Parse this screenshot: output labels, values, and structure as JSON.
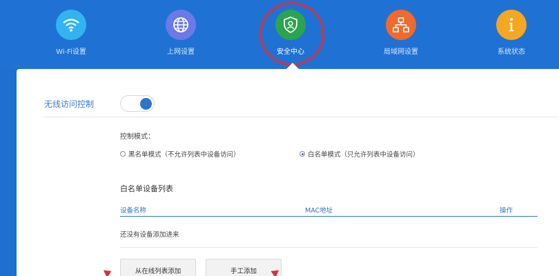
{
  "nav": {
    "items": [
      {
        "label": "Wi-Fi设置",
        "icon": "wifi-icon",
        "color": "#33b4f0"
      },
      {
        "label": "上网设置",
        "icon": "globe-icon",
        "color": "#6b7ae8"
      },
      {
        "label": "安全中心",
        "icon": "shield-user-icon",
        "color": "#2aa44f",
        "active": true
      },
      {
        "label": "局域网设置",
        "icon": "network-icon",
        "color": "#ef6a2c"
      },
      {
        "label": "系统状态",
        "icon": "info-icon",
        "color": "#f5a623"
      }
    ]
  },
  "colors": {
    "header_bg": "#1f72d4",
    "accent": "#2f74c9",
    "annotation_red": "#d8303b"
  },
  "wireless_access": {
    "title": "无线访问控制",
    "toggle_on": true
  },
  "control_mode": {
    "label": "控制模式：",
    "options": [
      {
        "label": "黑名单模式（不允许列表中设备访问）",
        "checked": false
      },
      {
        "label": "白名单模式（只允许列表中设备访问）",
        "checked": true
      }
    ]
  },
  "whitelist": {
    "title": "白名单设备列表",
    "columns": [
      "设备名称",
      "MAC地址",
      "操作"
    ],
    "empty_text": "还没有设备添加进来"
  },
  "buttons": {
    "add_from_online": "从在线列表添加",
    "manual_add": "手工添加"
  }
}
